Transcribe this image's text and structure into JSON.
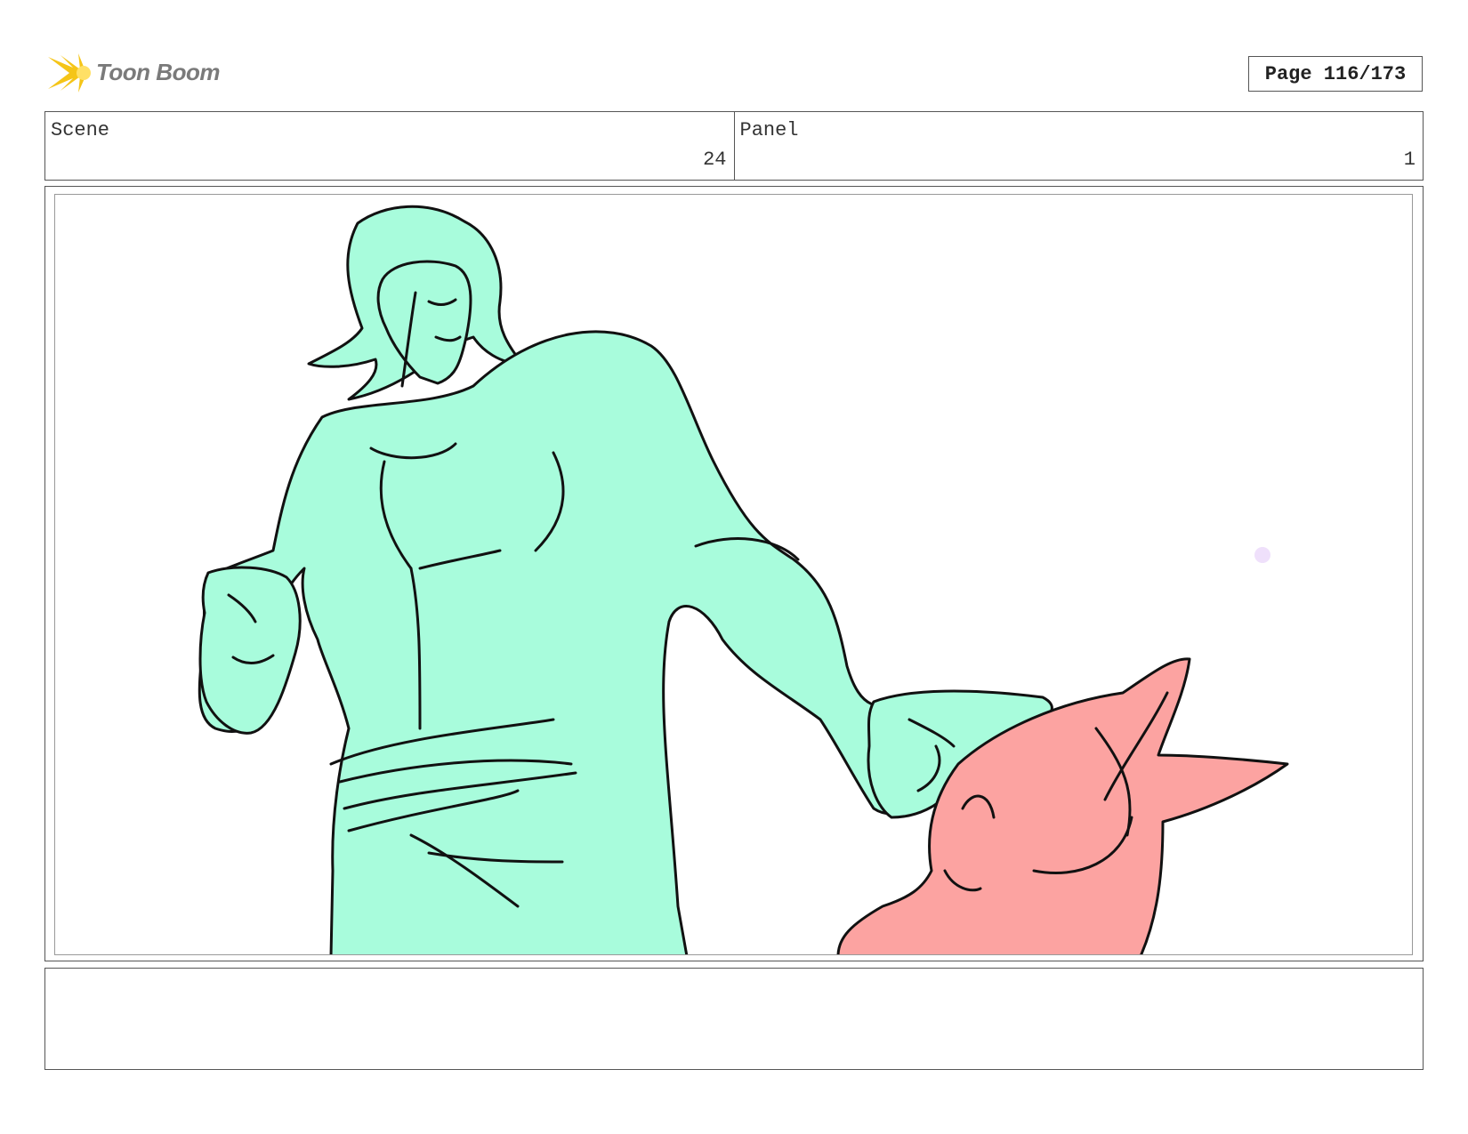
{
  "header": {
    "logo_text": "Toon Boom",
    "page_label": "Page 116/173"
  },
  "fields": {
    "scene": {
      "label": "Scene",
      "value": "24"
    },
    "panel": {
      "label": "Panel",
      "value": "1"
    }
  },
  "colors": {
    "character_fill": "#a8fcdc",
    "creature_fill": "#fca3a1",
    "line": "#111111",
    "dot": "#efe0fb",
    "logo_accent": "#f5c518"
  },
  "notes": {
    "text": ""
  }
}
